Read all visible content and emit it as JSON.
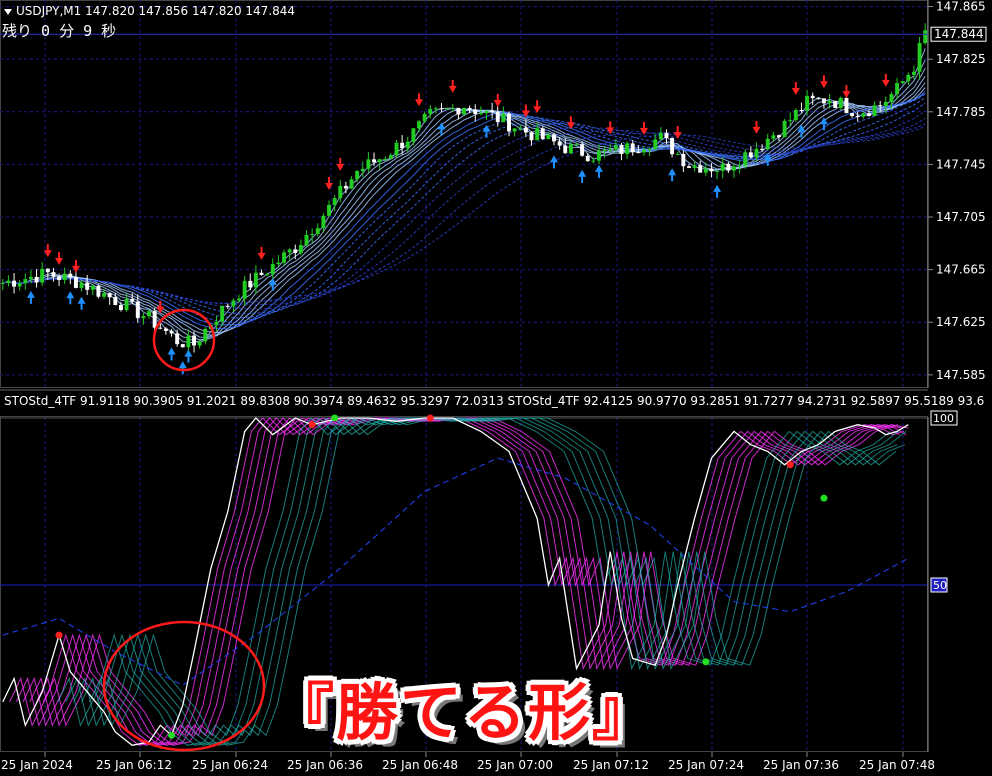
{
  "symbol_title": "USDJPY,M1  147.820 147.856 147.820 147.844",
  "countdown": "残り 0 分 9 秒",
  "current_price_label": "147.844",
  "oscillator_header": "STOStd_4TF 91.9118 90.3905 91.2021 89.8308 90.3974 89.4632 95.3297 72.0313  STOStd_4TF 92.4125 90.9770 93.2851 91.7277 94.2731 92.5897 95.5189 93.6",
  "caption": "『勝てる形』",
  "colors": {
    "background": "#000000",
    "bull_candle": "#22cc22",
    "bear_candle": "#ffffff",
    "up_arrow": "#1e90ff",
    "down_arrow": "#ff2020",
    "grid": "#1a1a8c",
    "highlight_circle": "#ff1a1a",
    "sto_main": "#ffffff",
    "sto_fast_band": "#ff33ff",
    "sto_slow_band": "#20b2aa",
    "sto_long": "#2244ff"
  },
  "chart_data": [
    {
      "type": "candlestick",
      "title": "USDJPY,M1",
      "ylim": [
        147.575,
        147.87
      ],
      "y_ticks": [
        "147.865",
        "147.825",
        "147.785",
        "147.745",
        "147.705",
        "147.665",
        "147.625",
        "147.585"
      ],
      "x_ticks": [
        "25 Jan 2024",
        "25 Jan 06:12",
        "25 Jan 06:24",
        "25 Jan 06:36",
        "25 Jan 06:48",
        "25 Jan 07:00",
        "25 Jan 07:12",
        "25 Jan 07:24",
        "25 Jan 07:36",
        "25 Jan 07:48"
      ],
      "current_price": 147.844,
      "approx_close_path": [
        [
          0,
          147.655
        ],
        [
          8,
          147.662
        ],
        [
          14,
          147.655
        ],
        [
          20,
          147.642
        ],
        [
          26,
          147.628
        ],
        [
          31,
          147.611
        ],
        [
          34,
          147.608
        ],
        [
          37,
          147.625
        ],
        [
          42,
          147.648
        ],
        [
          48,
          147.668
        ],
        [
          52,
          147.682
        ],
        [
          58,
          147.712
        ],
        [
          63,
          147.74
        ],
        [
          68,
          147.752
        ],
        [
          72,
          147.765
        ],
        [
          76,
          147.782
        ],
        [
          82,
          147.79
        ],
        [
          87,
          147.782
        ],
        [
          93,
          147.77
        ],
        [
          100,
          147.758
        ],
        [
          105,
          147.752
        ],
        [
          111,
          147.757
        ],
        [
          117,
          147.765
        ],
        [
          122,
          147.745
        ],
        [
          128,
          147.742
        ],
        [
          134,
          147.758
        ],
        [
          139,
          147.775
        ],
        [
          143,
          147.792
        ],
        [
          147,
          147.795
        ],
        [
          152,
          147.785
        ],
        [
          156,
          147.79
        ],
        [
          159,
          147.802
        ],
        [
          162,
          147.82
        ],
        [
          164,
          147.845
        ]
      ],
      "down_arrow_bars": [
        8,
        10,
        13,
        28,
        46,
        58,
        60,
        74,
        80,
        88,
        93,
        95,
        101,
        108,
        114,
        120,
        134,
        141,
        146,
        150,
        157
      ],
      "up_arrow_bars": [
        5,
        12,
        14,
        30,
        32,
        33,
        48,
        78,
        86,
        98,
        103,
        106,
        119,
        127,
        136,
        142,
        146
      ]
    },
    {
      "type": "line",
      "title": "STOStd_4TF",
      "ylim": [
        0,
        100
      ],
      "y_ticks": [
        "100",
        "50"
      ],
      "reference_levels": [
        100,
        50
      ],
      "series": [
        {
          "values": [
            [
              0,
              15
            ],
            [
              2,
              22
            ],
            [
              4,
              8
            ],
            [
              7,
              18
            ],
            [
              10,
              35
            ],
            [
              12,
              24
            ],
            [
              14,
              20
            ],
            [
              16,
              16
            ],
            [
              18,
              12
            ],
            [
              20,
              6
            ],
            [
              23,
              2
            ],
            [
              26,
              3
            ],
            [
              28,
              8
            ],
            [
              30,
              5
            ],
            [
              32,
              14
            ],
            [
              34,
              30
            ],
            [
              37,
              55
            ],
            [
              40,
              72
            ],
            [
              43,
              96
            ],
            [
              45,
              100
            ],
            [
              48,
              95
            ],
            [
              52,
              100
            ],
            [
              55,
              98
            ],
            [
              60,
              100
            ],
            [
              65,
              100
            ],
            [
              70,
              99
            ],
            [
              75,
              100
            ],
            [
              80,
              100
            ],
            [
              85,
              96
            ],
            [
              90,
              90
            ],
            [
              95,
              70
            ],
            [
              97,
              50
            ],
            [
              99,
              58
            ],
            [
              102,
              25
            ],
            [
              106,
              38
            ],
            [
              108,
              60
            ],
            [
              110,
              40
            ],
            [
              112,
              28
            ],
            [
              116,
              26
            ],
            [
              118,
              35
            ],
            [
              120,
              50
            ],
            [
              123,
              70
            ],
            [
              126,
              88
            ],
            [
              130,
              96
            ],
            [
              133,
              92
            ],
            [
              136,
              90
            ],
            [
              139,
              86
            ],
            [
              142,
              90
            ],
            [
              145,
              92
            ],
            [
              148,
              96
            ],
            [
              152,
              98
            ],
            [
              155,
              97
            ],
            [
              157,
              95
            ],
            [
              159,
              96
            ],
            [
              161,
              98
            ]
          ]
        },
        {
          "values": [
            [
              0,
              40
            ],
            [
              10,
              60
            ],
            [
              20,
              30
            ],
            [
              30,
              10
            ],
            [
              40,
              70
            ],
            [
              50,
              96
            ],
            [
              60,
              100
            ],
            [
              70,
              98
            ],
            [
              80,
              95
            ],
            [
              90,
              85
            ],
            [
              100,
              55
            ],
            [
              110,
              50
            ],
            [
              120,
              48
            ],
            [
              130,
              80
            ],
            [
              140,
              80
            ],
            [
              150,
              88
            ],
            [
              161,
              90
            ]
          ]
        },
        {
          "values": [
            [
              0,
              35
            ],
            [
              10,
              40
            ],
            [
              20,
              30
            ],
            [
              32,
              20
            ],
            [
              45,
              35
            ],
            [
              60,
              55
            ],
            [
              75,
              78
            ],
            [
              88,
              88
            ],
            [
              100,
              82
            ],
            [
              115,
              68
            ],
            [
              130,
              45
            ],
            [
              140,
              42
            ],
            [
              150,
              48
            ],
            [
              161,
              58
            ]
          ]
        }
      ]
    }
  ]
}
